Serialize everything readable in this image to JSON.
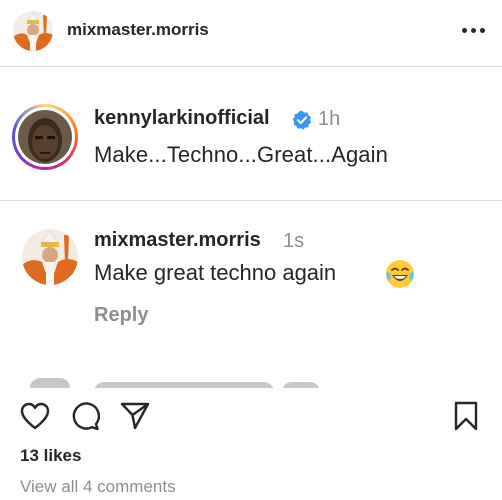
{
  "header": {
    "username": "mixmaster.morris",
    "avatar_icon": "mixmaster-avatar-icon",
    "more_icon": "more-options-icon"
  },
  "comments": [
    {
      "username": "kennylarkinofficial",
      "verified": true,
      "time": "1h",
      "text": "Make...Techno...Great...Again",
      "avatar_icon": "kennylarkin-avatar-icon",
      "has_story_ring": true
    },
    {
      "username": "mixmaster.morris",
      "verified": false,
      "time": "1s",
      "text": "Make great techno again",
      "emoji": "face-with-tears-of-joy",
      "reply_label": "Reply",
      "avatar_icon": "mixmaster-avatar-icon"
    }
  ],
  "actions": {
    "like_icon": "heart-icon",
    "comment_icon": "comment-icon",
    "share_icon": "share-icon",
    "save_icon": "bookmark-icon"
  },
  "likes_text": "13 likes",
  "view_all_text": "View all 4 comments",
  "colors": {
    "text": "#262626",
    "muted": "#8e8e8e",
    "verified": "#3897f0",
    "divider": "#dbdbdb"
  }
}
